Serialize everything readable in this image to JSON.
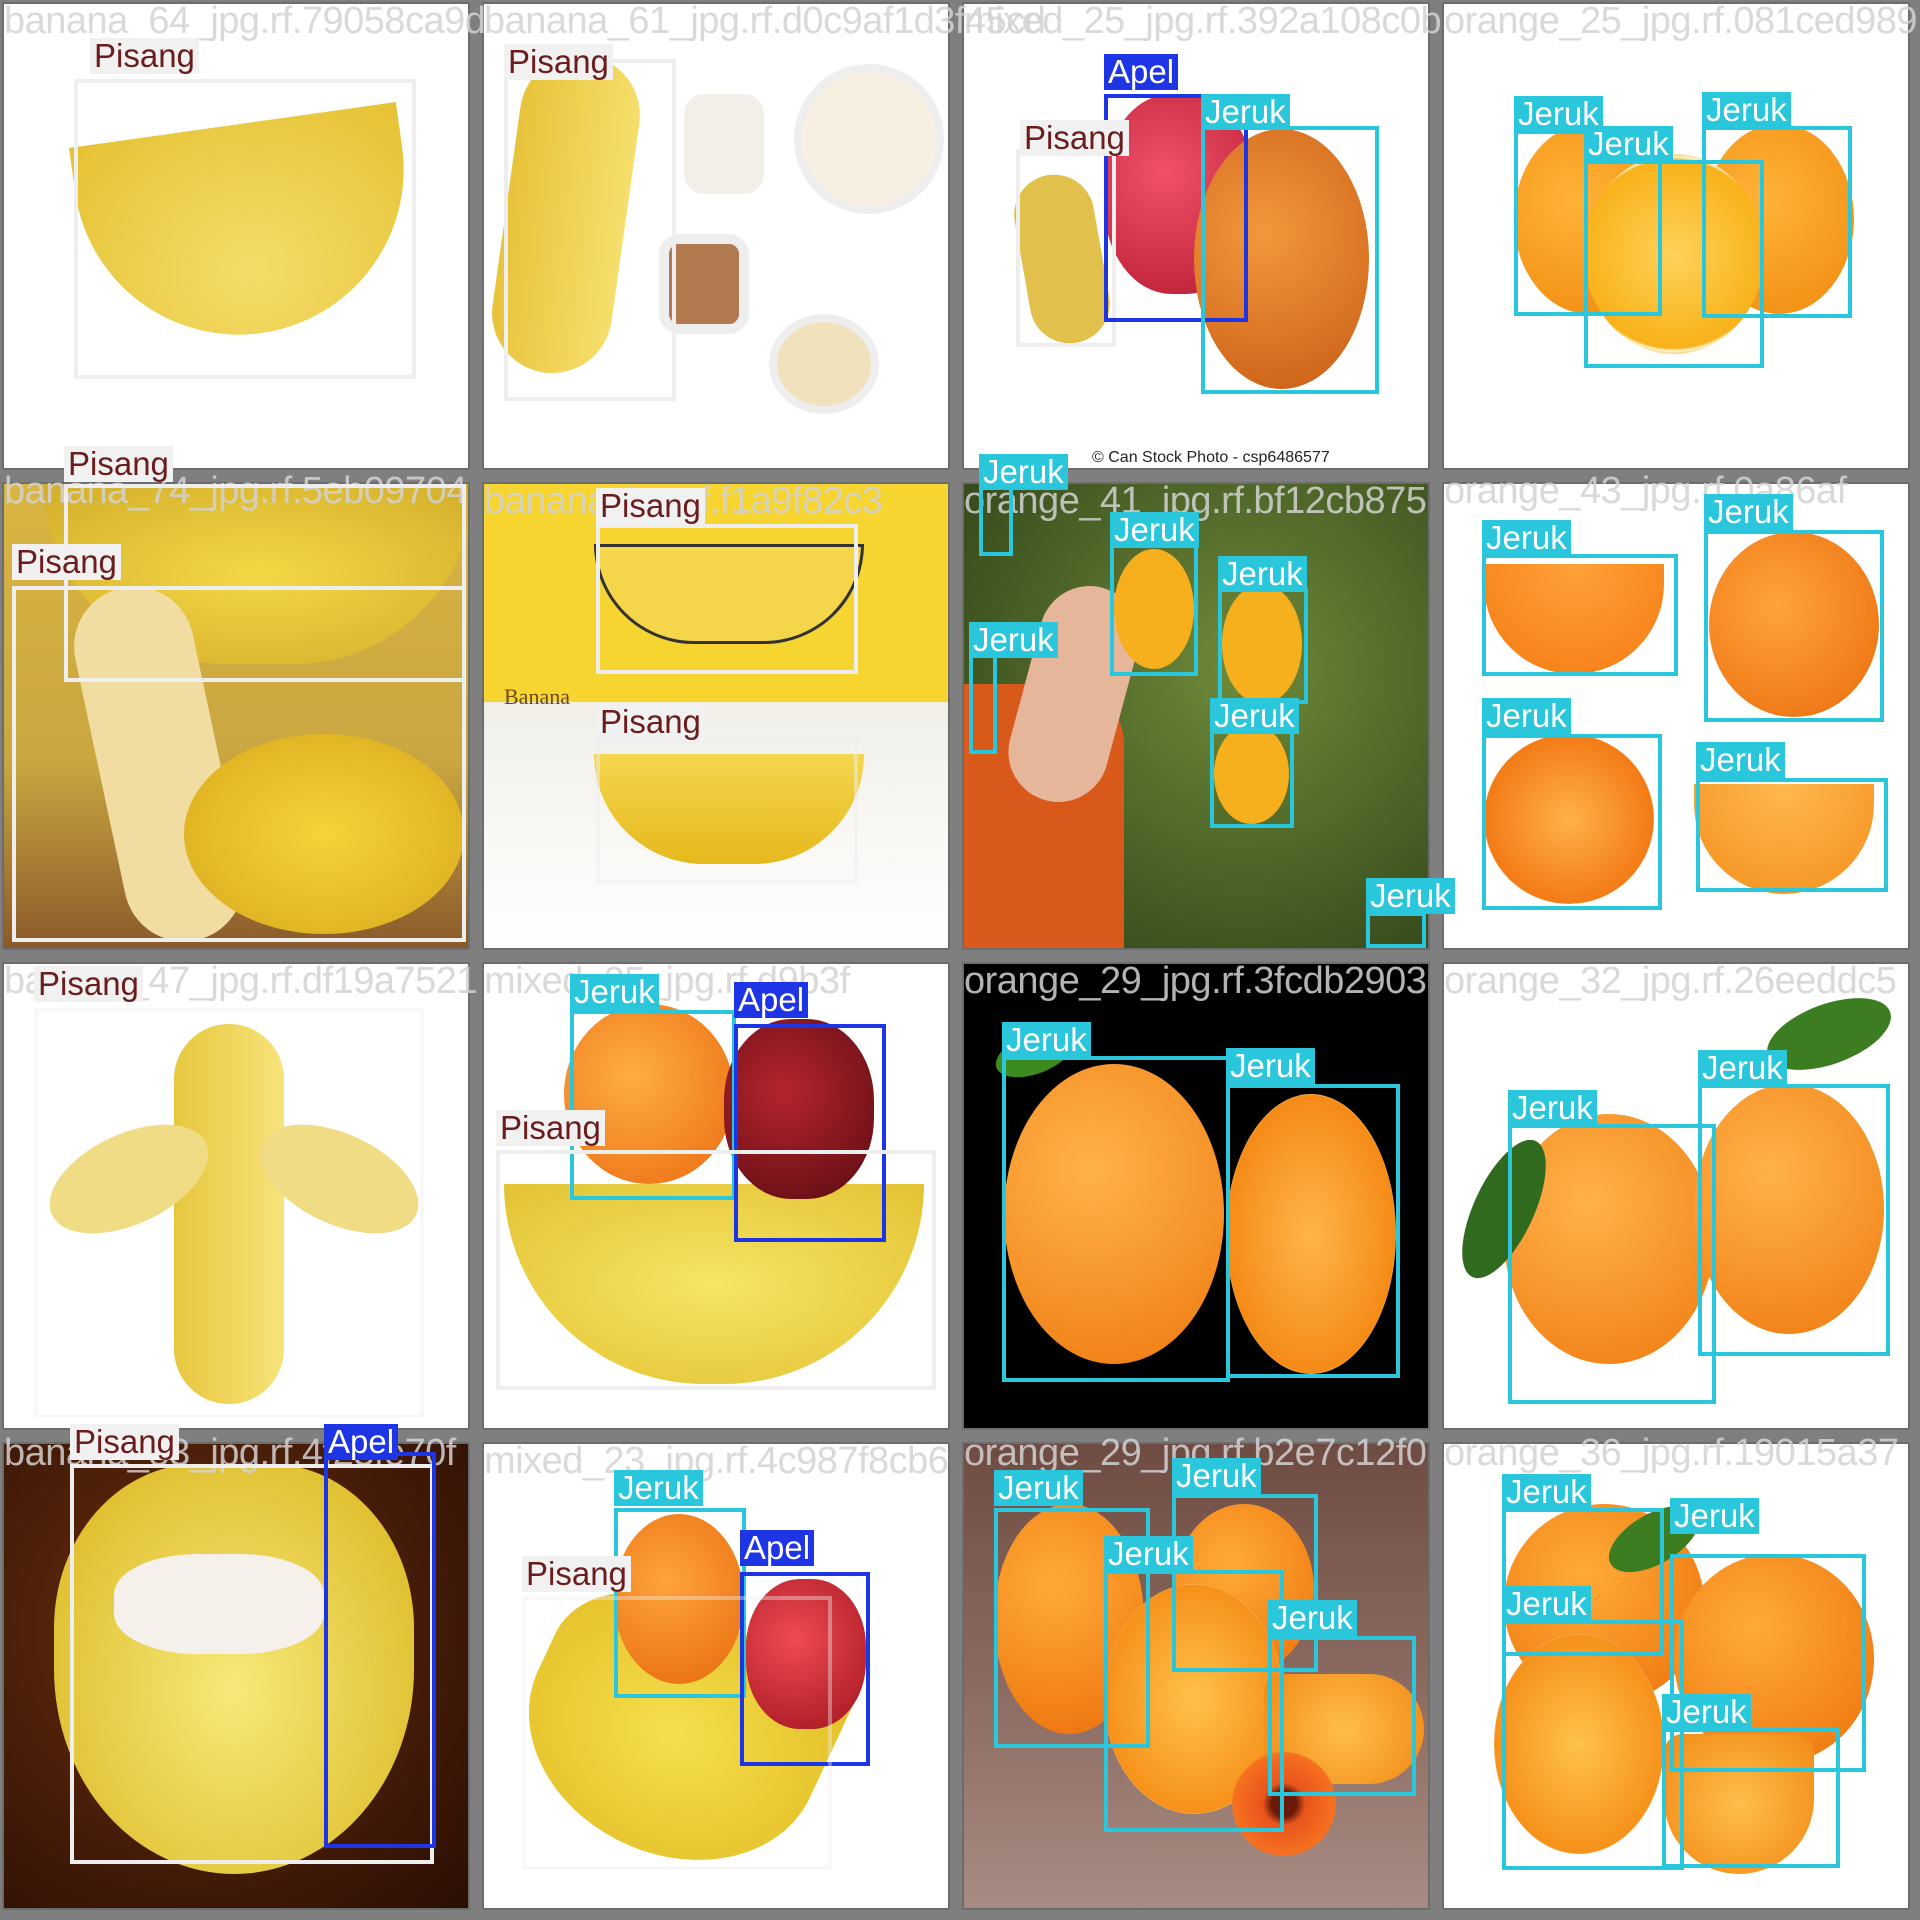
{
  "colors": {
    "pisang_box": "#eeeeee",
    "pisang_label_bg": "#f1f1f1",
    "pisang_label_text": "#6b1c1c",
    "jeruk_box": "#29c6dc",
    "apel_box": "#1e35e6",
    "frame": "#7f7f7f"
  },
  "labels": {
    "pisang": "Pisang",
    "jeruk": "Jeruk",
    "apel": "Apel"
  },
  "tiles": [
    {
      "filename": "banana_64_jpg.rf.79058ca9d",
      "watermark": ""
    },
    {
      "filename": "banana_61_jpg.rf.d0c9af1d3f45cd",
      "watermark": ""
    },
    {
      "filename": "mixed_25_jpg.rf.392a108c0b",
      "watermark": "© Can Stock Photo - csp6486577"
    },
    {
      "filename": "orange_25_jpg.rf.081ced989",
      "watermark": ""
    },
    {
      "filename": "banana_74_jpg.rf.5eb09704",
      "watermark": ""
    },
    {
      "filename": "banana_jpg.rf.f1a9f82c3",
      "watermark": "Banana"
    },
    {
      "filename": "orange_41_jpg.rf.bf12cb875",
      "watermark": ""
    },
    {
      "filename": "orange_43_jpg.rf.0a86af",
      "watermark": ""
    },
    {
      "filename": "banana_47_jpg.rf.df19a7521",
      "watermark": ""
    },
    {
      "filename": "mixed_05_jpg.rf.d9b3f",
      "watermark": ""
    },
    {
      "filename": "orange_29_jpg.rf.3fcdb2903",
      "watermark": ""
    },
    {
      "filename": "orange_32_jpg.rf.26eeddc5",
      "watermark": ""
    },
    {
      "filename": "banana_83_jpg.rf.4f23fe70f",
      "watermark": ""
    },
    {
      "filename": "mixed_23_jpg.rf.4c987f8cb6",
      "watermark": ""
    },
    {
      "filename": "orange_29_jpg.rf.b2e7c12f0",
      "watermark": ""
    },
    {
      "filename": "orange_36_jpg.rf.19015a37",
      "watermark": ""
    }
  ]
}
